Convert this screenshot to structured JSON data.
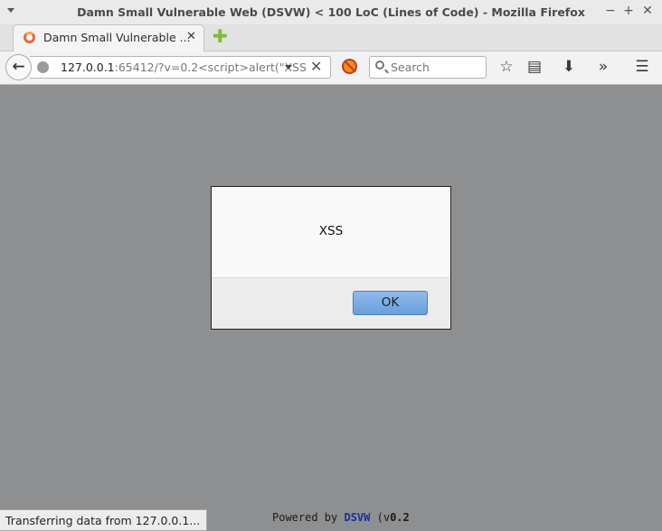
{
  "window": {
    "title": "Damn Small Vulnerable Web (DSVW) < 100 LoC (Lines of Code) - Mozilla Firefox",
    "controls": {
      "minimize": "−",
      "maximize": "+",
      "close": "✕"
    }
  },
  "tabs": [
    {
      "title": "Damn Small Vulnerable ...",
      "close": "✕"
    }
  ],
  "newtab": {
    "label": "✚"
  },
  "nav": {
    "back": "←",
    "url_host": "127.0.0.1",
    "url_rest": ":65412/?v=0.2<script>alert(\"XSS",
    "url_stop": "✕",
    "search_placeholder": "Search",
    "bookmark": "☆",
    "reading_list": "▤",
    "downloads": "⬇",
    "overflow": "»",
    "menu": "☰"
  },
  "dialog": {
    "message": "XSS",
    "ok_label": "OK"
  },
  "page": {
    "footer_prefix": "Powered by ",
    "footer_link": "DSVW",
    "footer_mid": " (v",
    "footer_version": "0.2"
  },
  "status": {
    "text": "Transferring data from 127.0.0.1..."
  },
  "colors": {
    "content_bg": "#8e8f90",
    "ok_button": "#6a9fdc",
    "dsvw_link": "#1a2f9c"
  }
}
